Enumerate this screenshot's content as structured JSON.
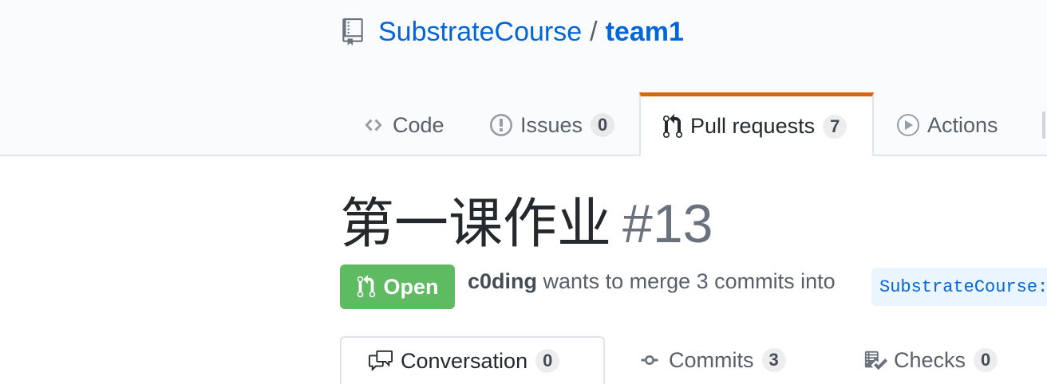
{
  "repo": {
    "owner": "SubstrateCourse",
    "separator": "/",
    "name": "team1",
    "icon": "repo-icon"
  },
  "nav": {
    "tabs": [
      {
        "label": "Code",
        "icon": "code-icon"
      },
      {
        "label": "Issues",
        "count": "0",
        "icon": "issue-opened-icon"
      },
      {
        "label": "Pull requests",
        "count": "7",
        "icon": "git-pull-request-icon",
        "selected": true
      },
      {
        "label": "Actions",
        "icon": "play-icon"
      }
    ]
  },
  "pr": {
    "title": "第一课作业",
    "number": "#13",
    "state": "Open",
    "author": "c0ding",
    "summary": "wants to merge 3 commits into",
    "base_branch": "SubstrateCourse:"
  },
  "pr_tabs": [
    {
      "label": "Conversation",
      "count": "0",
      "icon": "comment-discussion-icon",
      "selected": true
    },
    {
      "label": "Commits",
      "count": "3",
      "icon": "git-commit-icon"
    },
    {
      "label": "Checks",
      "count": "0",
      "icon": "checklist-icon"
    }
  ],
  "colors": {
    "accent": "#e36209",
    "link": "#0366d6",
    "open": "#5fbb61"
  }
}
